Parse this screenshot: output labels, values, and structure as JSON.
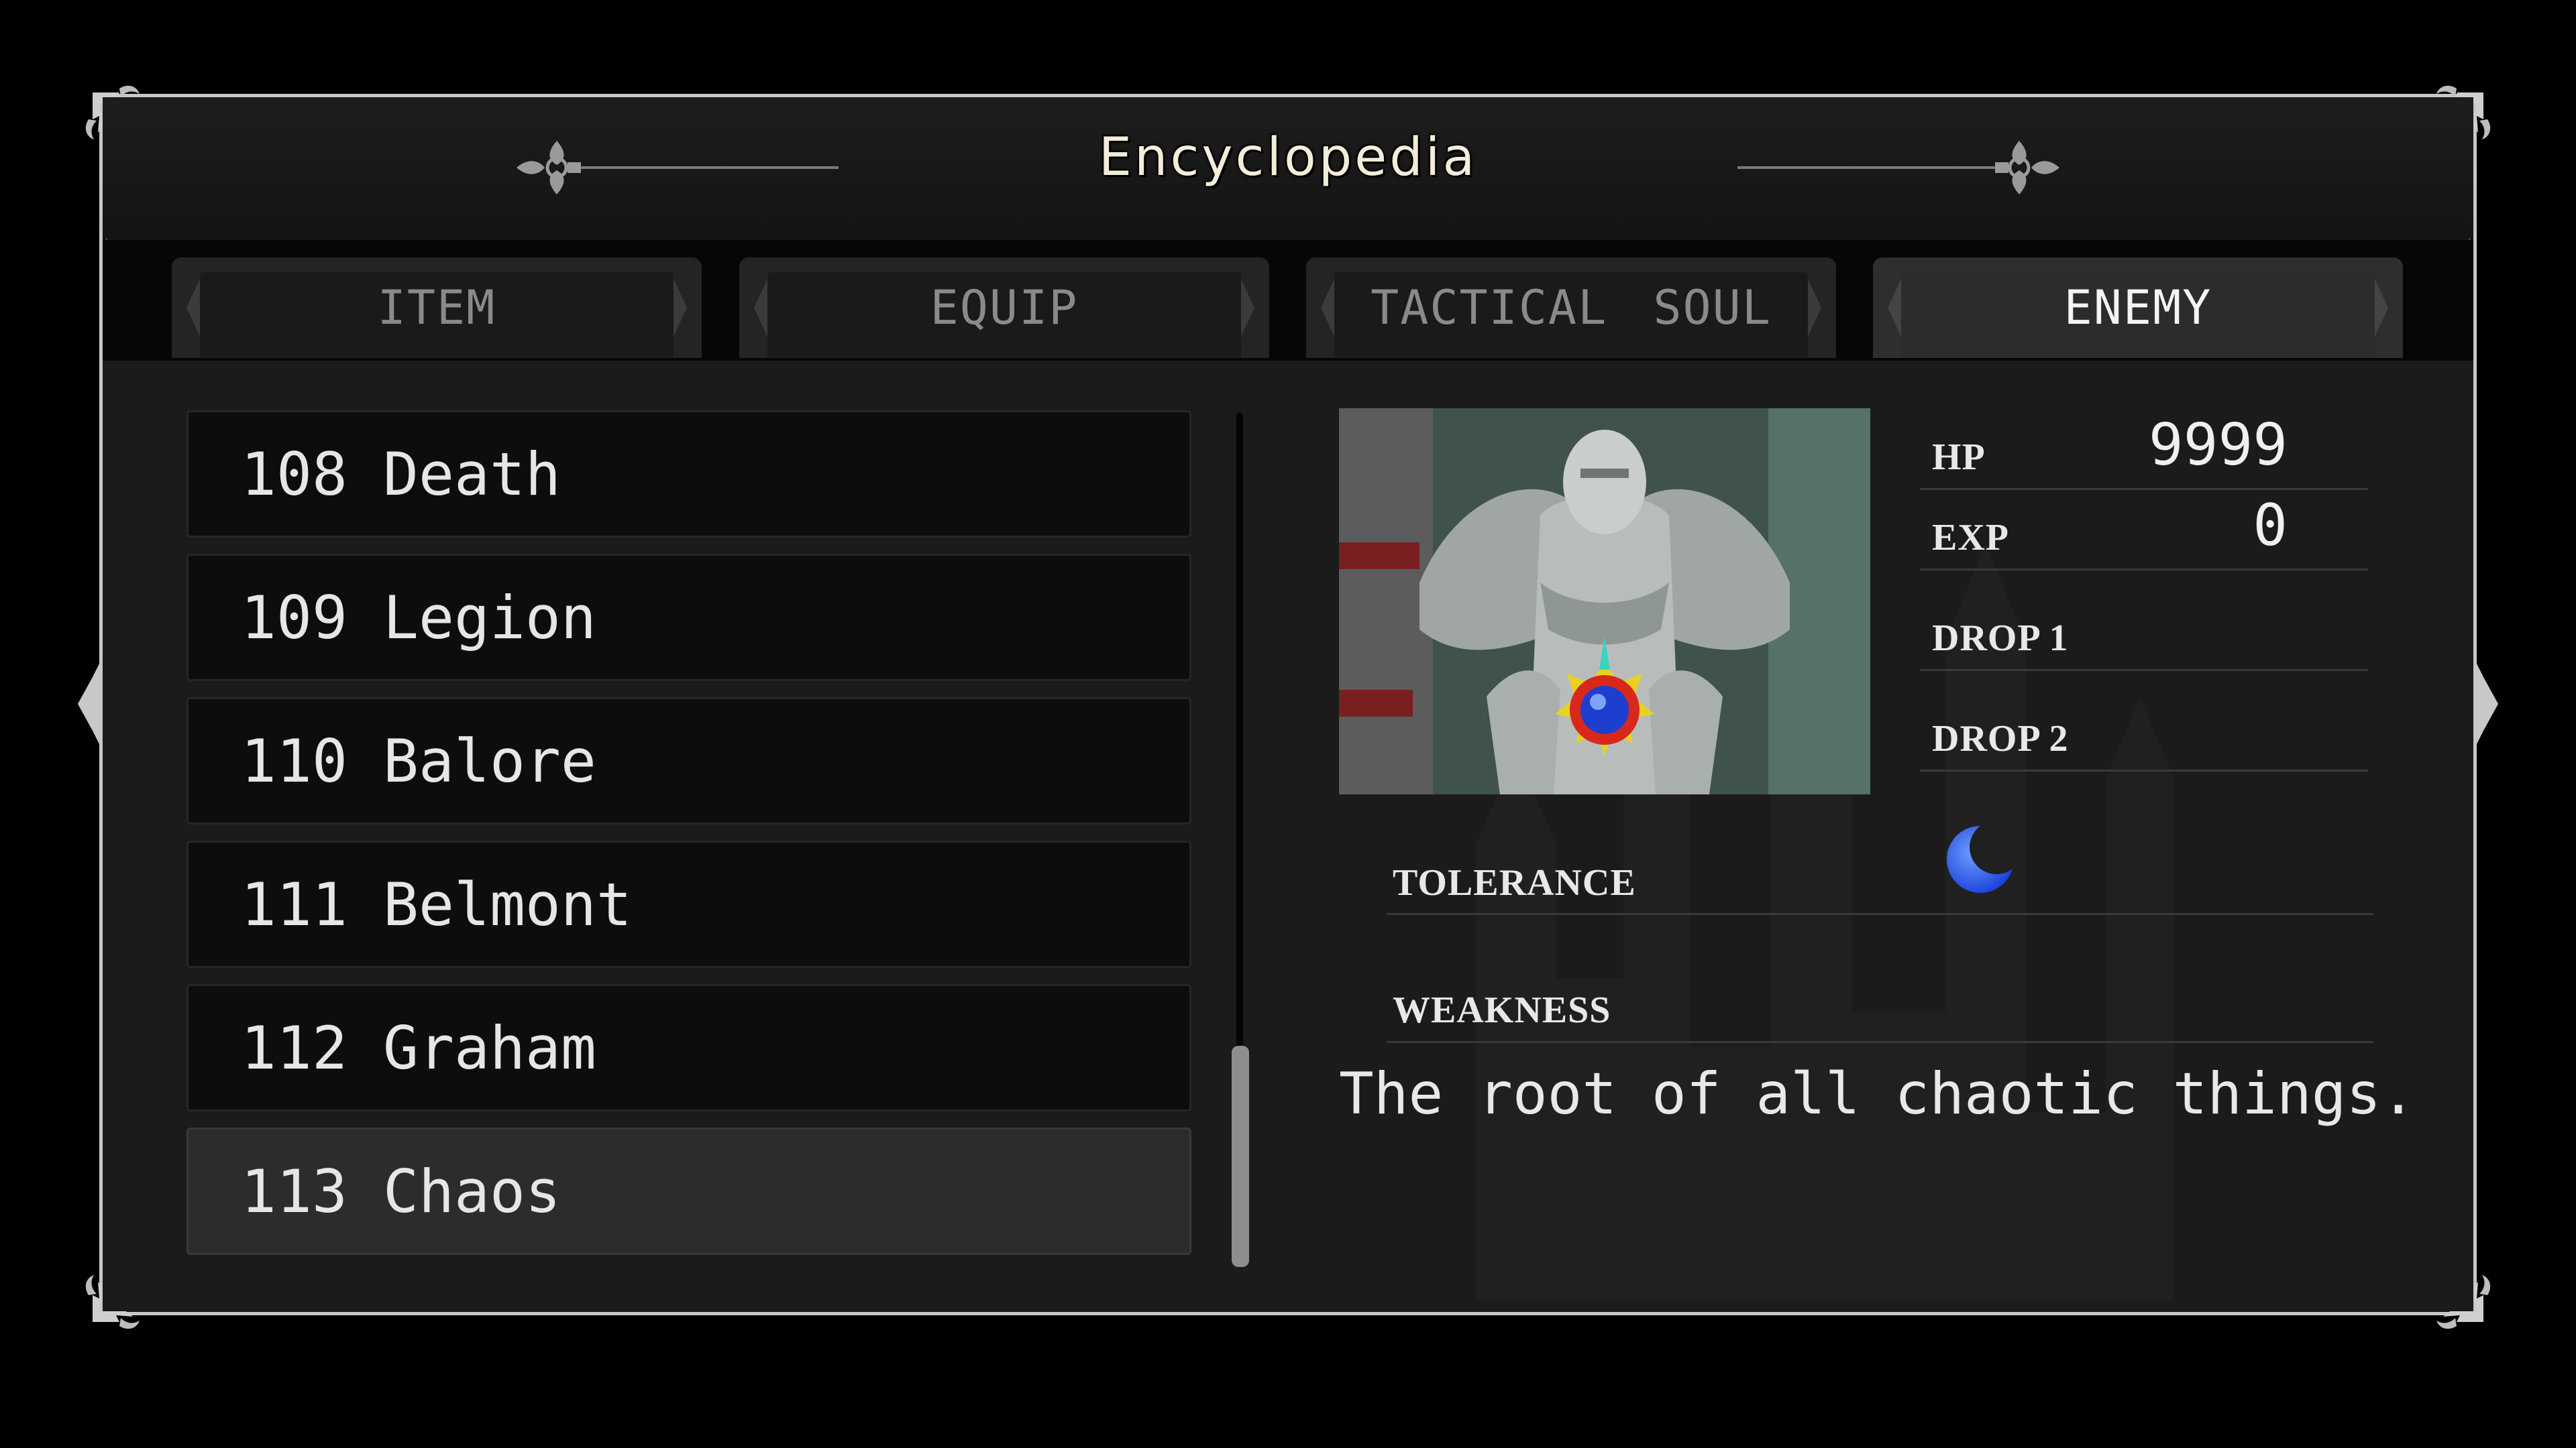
{
  "title": "Encyclopedia",
  "tabs": [
    {
      "label": "ITEM",
      "active": false
    },
    {
      "label": "EQUIP",
      "active": false
    },
    {
      "label": "TACTICAL SOUL",
      "active": false
    },
    {
      "label": "ENEMY",
      "active": true
    }
  ],
  "enemy_list": [
    {
      "number": "108",
      "name": "Death"
    },
    {
      "number": "109",
      "name": "Legion"
    },
    {
      "number": "110",
      "name": "Balore"
    },
    {
      "number": "111",
      "name": "Belmont"
    },
    {
      "number": "112",
      "name": "Graham"
    },
    {
      "number": "113",
      "name": "Chaos",
      "selected": true
    }
  ],
  "details": {
    "hp_label": "HP",
    "hp_value": "9999",
    "exp_label": "EXP",
    "exp_value": "0",
    "drop1_label": "DROP 1",
    "drop2_label": "DROP 2",
    "tolerance_label": "TOLERANCE",
    "tolerance_icon": "crescent-moon-icon",
    "weakness_label": "WEAKNESS",
    "description": "The root of all chaotic things."
  },
  "scroll_position": 1.0,
  "colors": {
    "accent_tab_active": "#2e2e2e",
    "moon_icon": "#1a4cf0"
  }
}
